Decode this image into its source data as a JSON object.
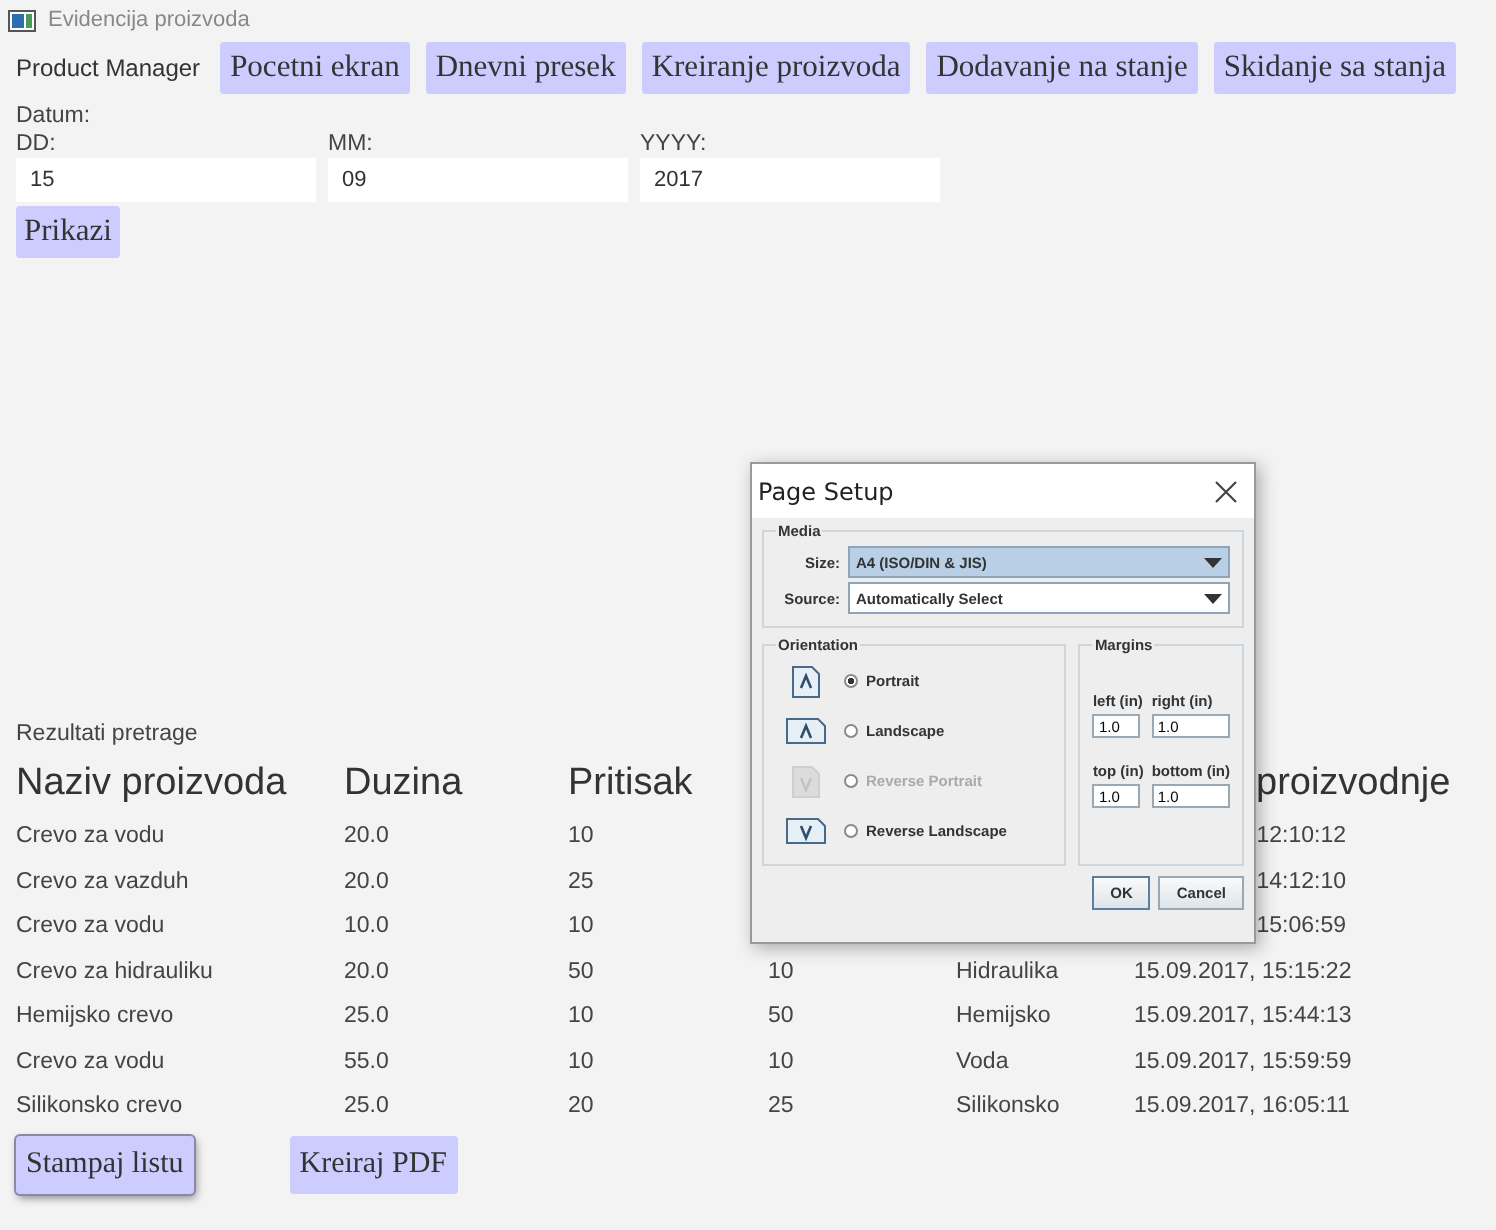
{
  "window": {
    "title": "Evidencija proizvoda"
  },
  "app_label": "Product Manager",
  "nav_buttons": [
    "Pocetni ekran",
    "Dnevni presek",
    "Kreiranje proizvoda",
    "Dodavanje na stanje",
    "Skidanje sa stanja"
  ],
  "date_section": {
    "label": "Datum:",
    "fields": [
      {
        "label": "DD:",
        "value": "15"
      },
      {
        "label": "MM:",
        "value": "09"
      },
      {
        "label": "YYYY:",
        "value": "2017"
      }
    ]
  },
  "show_button": "Prikazi",
  "results": {
    "label": "Rezultati pretrage",
    "columns": [
      "Naziv proizvoda",
      "Duzina",
      "Pritisak",
      null,
      null,
      "proizvodnje"
    ],
    "rows": [
      {
        "cells": [
          "Crevo za vodu",
          "20.0",
          "10",
          null,
          null,
          "12:10:12"
        ]
      },
      {
        "cells": [
          "Crevo za vazduh",
          "20.0",
          "25",
          null,
          null,
          "14:12:10"
        ]
      },
      {
        "cells": [
          "Crevo za vodu",
          "10.0",
          "10",
          null,
          null,
          "15:06:59"
        ]
      },
      {
        "cells": [
          "Crevo za hidrauliku",
          "20.0",
          "50",
          "10",
          "Hidraulika",
          "15.09.2017, 15:15:22"
        ]
      },
      {
        "cells": [
          "Hemijsko crevo",
          "25.0",
          "10",
          "50",
          "Hemijsko",
          "15.09.2017, 15:44:13"
        ]
      },
      {
        "cells": [
          "Crevo za vodu",
          "55.0",
          "10",
          "10",
          "Voda",
          "15.09.2017, 15:59:59"
        ]
      },
      {
        "cells": [
          "Silikonsko crevo",
          "25.0",
          "20",
          "25",
          "Silikonsko",
          "15.09.2017, 16:05:11"
        ]
      }
    ]
  },
  "bottom_buttons": [
    {
      "label": "Stampaj listu",
      "focused": true
    },
    {
      "label": "Kreiraj PDF",
      "focused": false
    }
  ],
  "dialog": {
    "title": "Page Setup",
    "media": {
      "label": "Media",
      "combos": [
        {
          "label": "Size:",
          "value": "A4 (ISO/DIN & JIS)",
          "selected": true
        },
        {
          "label": "Source:",
          "value": "Automatically Select",
          "selected": false
        }
      ]
    },
    "orientation": {
      "label": "Orientation",
      "options": [
        {
          "kind": "portrait",
          "label": "Portrait",
          "selected": true,
          "disabled": false
        },
        {
          "kind": "landscape",
          "label": "Landscape",
          "selected": false,
          "disabled": false
        },
        {
          "kind": "reverse-portrait",
          "label": "Reverse Portrait",
          "selected": false,
          "disabled": true
        },
        {
          "kind": "reverse-landscape",
          "label": "Reverse Landscape",
          "selected": false,
          "disabled": false
        }
      ]
    },
    "margins": {
      "label": "Margins",
      "fields": [
        {
          "label": "left (in)",
          "value": "1.0"
        },
        {
          "label": "right (in)",
          "value": "1.0"
        },
        {
          "label": "top (in)",
          "value": "1.0"
        },
        {
          "label": "bottom (in)",
          "value": "1.0"
        }
      ]
    },
    "buttons": [
      {
        "label": "OK",
        "focused": true
      },
      {
        "label": "Cancel",
        "focused": false
      }
    ]
  }
}
